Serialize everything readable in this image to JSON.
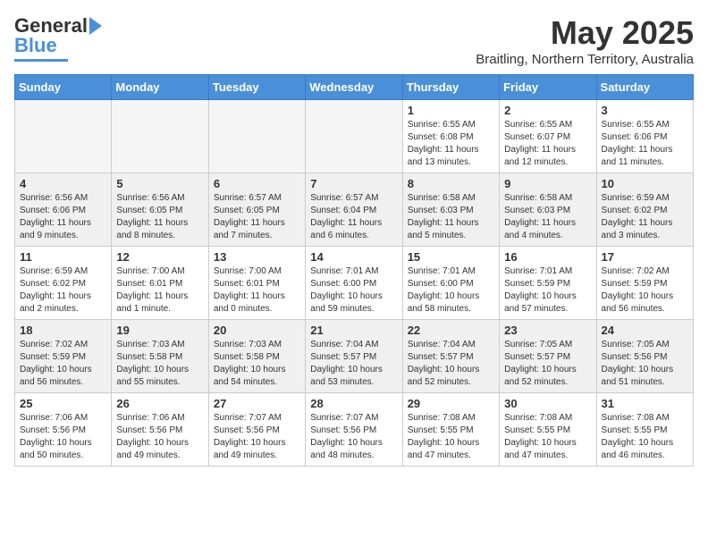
{
  "header": {
    "logo_line1": "General",
    "logo_line2": "Blue",
    "month": "May 2025",
    "location": "Braitling, Northern Territory, Australia"
  },
  "weekdays": [
    "Sunday",
    "Monday",
    "Tuesday",
    "Wednesday",
    "Thursday",
    "Friday",
    "Saturday"
  ],
  "weeks": [
    [
      {
        "day": "",
        "info": ""
      },
      {
        "day": "",
        "info": ""
      },
      {
        "day": "",
        "info": ""
      },
      {
        "day": "",
        "info": ""
      },
      {
        "day": "1",
        "info": "Sunrise: 6:55 AM\nSunset: 6:08 PM\nDaylight: 11 hours\nand 13 minutes."
      },
      {
        "day": "2",
        "info": "Sunrise: 6:55 AM\nSunset: 6:07 PM\nDaylight: 11 hours\nand 12 minutes."
      },
      {
        "day": "3",
        "info": "Sunrise: 6:55 AM\nSunset: 6:06 PM\nDaylight: 11 hours\nand 11 minutes."
      }
    ],
    [
      {
        "day": "4",
        "info": "Sunrise: 6:56 AM\nSunset: 6:06 PM\nDaylight: 11 hours\nand 9 minutes."
      },
      {
        "day": "5",
        "info": "Sunrise: 6:56 AM\nSunset: 6:05 PM\nDaylight: 11 hours\nand 8 minutes."
      },
      {
        "day": "6",
        "info": "Sunrise: 6:57 AM\nSunset: 6:05 PM\nDaylight: 11 hours\nand 7 minutes."
      },
      {
        "day": "7",
        "info": "Sunrise: 6:57 AM\nSunset: 6:04 PM\nDaylight: 11 hours\nand 6 minutes."
      },
      {
        "day": "8",
        "info": "Sunrise: 6:58 AM\nSunset: 6:03 PM\nDaylight: 11 hours\nand 5 minutes."
      },
      {
        "day": "9",
        "info": "Sunrise: 6:58 AM\nSunset: 6:03 PM\nDaylight: 11 hours\nand 4 minutes."
      },
      {
        "day": "10",
        "info": "Sunrise: 6:59 AM\nSunset: 6:02 PM\nDaylight: 11 hours\nand 3 minutes."
      }
    ],
    [
      {
        "day": "11",
        "info": "Sunrise: 6:59 AM\nSunset: 6:02 PM\nDaylight: 11 hours\nand 2 minutes."
      },
      {
        "day": "12",
        "info": "Sunrise: 7:00 AM\nSunset: 6:01 PM\nDaylight: 11 hours\nand 1 minute."
      },
      {
        "day": "13",
        "info": "Sunrise: 7:00 AM\nSunset: 6:01 PM\nDaylight: 11 hours\nand 0 minutes."
      },
      {
        "day": "14",
        "info": "Sunrise: 7:01 AM\nSunset: 6:00 PM\nDaylight: 10 hours\nand 59 minutes."
      },
      {
        "day": "15",
        "info": "Sunrise: 7:01 AM\nSunset: 6:00 PM\nDaylight: 10 hours\nand 58 minutes."
      },
      {
        "day": "16",
        "info": "Sunrise: 7:01 AM\nSunset: 5:59 PM\nDaylight: 10 hours\nand 57 minutes."
      },
      {
        "day": "17",
        "info": "Sunrise: 7:02 AM\nSunset: 5:59 PM\nDaylight: 10 hours\nand 56 minutes."
      }
    ],
    [
      {
        "day": "18",
        "info": "Sunrise: 7:02 AM\nSunset: 5:59 PM\nDaylight: 10 hours\nand 56 minutes."
      },
      {
        "day": "19",
        "info": "Sunrise: 7:03 AM\nSunset: 5:58 PM\nDaylight: 10 hours\nand 55 minutes."
      },
      {
        "day": "20",
        "info": "Sunrise: 7:03 AM\nSunset: 5:58 PM\nDaylight: 10 hours\nand 54 minutes."
      },
      {
        "day": "21",
        "info": "Sunrise: 7:04 AM\nSunset: 5:57 PM\nDaylight: 10 hours\nand 53 minutes."
      },
      {
        "day": "22",
        "info": "Sunrise: 7:04 AM\nSunset: 5:57 PM\nDaylight: 10 hours\nand 52 minutes."
      },
      {
        "day": "23",
        "info": "Sunrise: 7:05 AM\nSunset: 5:57 PM\nDaylight: 10 hours\nand 52 minutes."
      },
      {
        "day": "24",
        "info": "Sunrise: 7:05 AM\nSunset: 5:56 PM\nDaylight: 10 hours\nand 51 minutes."
      }
    ],
    [
      {
        "day": "25",
        "info": "Sunrise: 7:06 AM\nSunset: 5:56 PM\nDaylight: 10 hours\nand 50 minutes."
      },
      {
        "day": "26",
        "info": "Sunrise: 7:06 AM\nSunset: 5:56 PM\nDaylight: 10 hours\nand 49 minutes."
      },
      {
        "day": "27",
        "info": "Sunrise: 7:07 AM\nSunset: 5:56 PM\nDaylight: 10 hours\nand 49 minutes."
      },
      {
        "day": "28",
        "info": "Sunrise: 7:07 AM\nSunset: 5:56 PM\nDaylight: 10 hours\nand 48 minutes."
      },
      {
        "day": "29",
        "info": "Sunrise: 7:08 AM\nSunset: 5:55 PM\nDaylight: 10 hours\nand 47 minutes."
      },
      {
        "day": "30",
        "info": "Sunrise: 7:08 AM\nSunset: 5:55 PM\nDaylight: 10 hours\nand 47 minutes."
      },
      {
        "day": "31",
        "info": "Sunrise: 7:08 AM\nSunset: 5:55 PM\nDaylight: 10 hours\nand 46 minutes."
      }
    ]
  ]
}
